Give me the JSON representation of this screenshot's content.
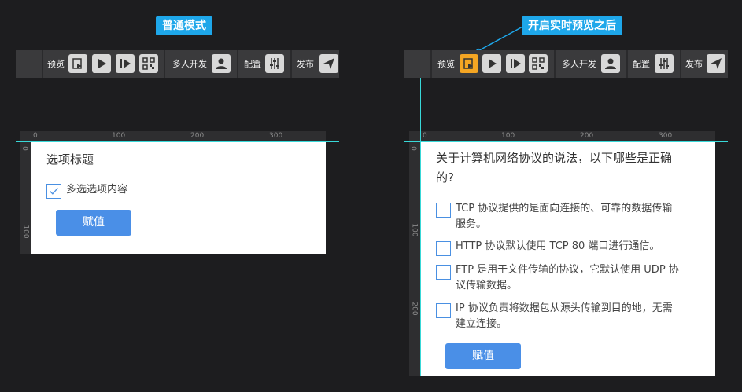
{
  "left": {
    "badge": "普通模式",
    "toolbar": {
      "preview_label": "预览",
      "multi_dev_label": "多人开发",
      "config_label": "配置",
      "publish_label": "发布"
    },
    "ruler": {
      "x_ticks": [
        "0",
        "100",
        "200",
        "300"
      ],
      "y_ticks": [
        "0",
        "100"
      ]
    },
    "form": {
      "title": "选项标题",
      "option": "多选选项内容",
      "option_checked": true,
      "button": "赋值"
    }
  },
  "right": {
    "badge": "开启实时预览之后",
    "toolbar": {
      "preview_label": "预览",
      "multi_dev_label": "多人开发",
      "config_label": "配置",
      "publish_label": "发布",
      "realtime_preview_active": true
    },
    "ruler": {
      "x_ticks": [
        "0",
        "100",
        "200",
        "300"
      ],
      "y_ticks": [
        "0",
        "100",
        "200"
      ]
    },
    "form": {
      "question_line1": "关于计算机网络协议的说法，以下哪些是正确",
      "question_line2": "的?",
      "options": [
        {
          "line1": "TCP 协议提供的是面向连接的、可靠的数据传输",
          "line2": "服务。"
        },
        {
          "line1": "HTTP 协议默认使用 TCP 80 端口进行通信。",
          "line2": ""
        },
        {
          "line1": "FTP 是用于文件传输的协议，它默认使用 UDP 协",
          "line2": "议传输数据。"
        },
        {
          "line1": "IP 协议负责将数据包从源头传输到目的地，无需",
          "line2": "建立连接。"
        }
      ],
      "button": "赋值"
    }
  },
  "colors": {
    "accent": "#1ea7ea",
    "active": "#f5a623",
    "button": "#4a8fe7",
    "guide": "#38d8d8"
  },
  "icons": [
    "preview-icon",
    "play-icon",
    "play-forward-icon",
    "qrcode-icon",
    "user-icon",
    "sliders-icon",
    "send-icon"
  ]
}
